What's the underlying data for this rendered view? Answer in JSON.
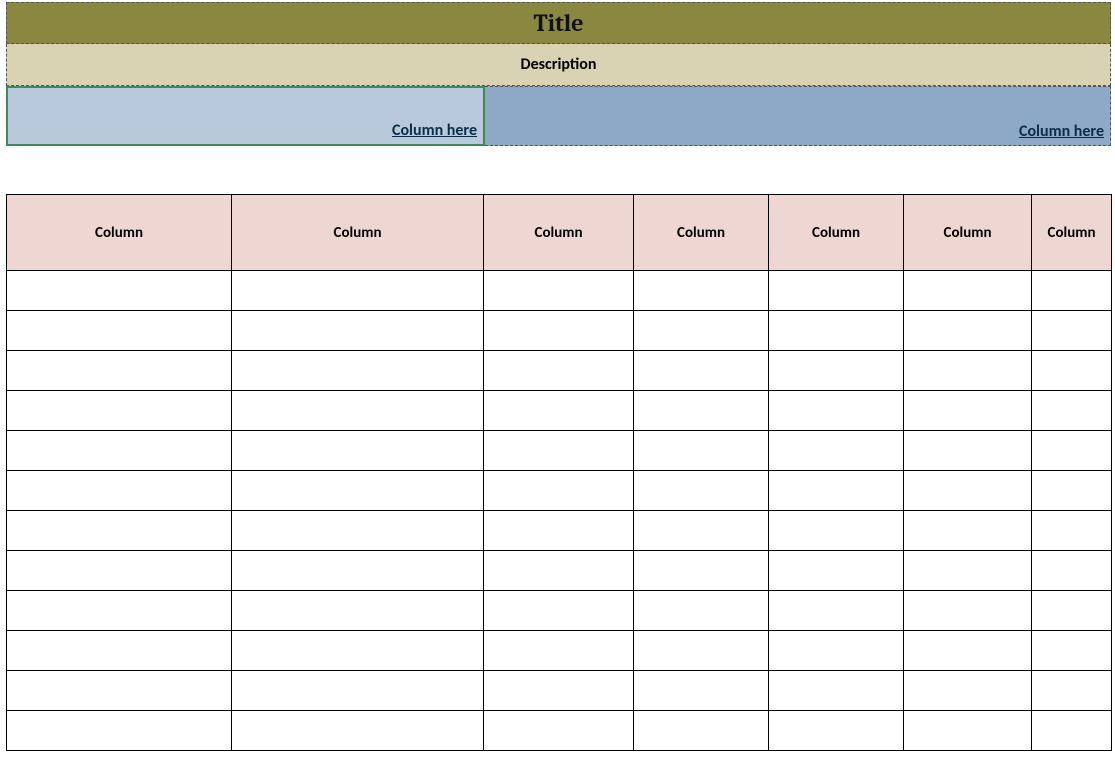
{
  "header": {
    "title": "Title",
    "description": "Description"
  },
  "groups": {
    "left_label": "Column here",
    "right_label": "Column here"
  },
  "table": {
    "columns": [
      "Column",
      "Column",
      "Column",
      "Column",
      "Column",
      "Column",
      "Column"
    ],
    "rows": [
      [
        "",
        "",
        "",
        "",
        "",
        "",
        ""
      ],
      [
        "",
        "",
        "",
        "",
        "",
        "",
        ""
      ],
      [
        "",
        "",
        "",
        "",
        "",
        "",
        ""
      ],
      [
        "",
        "",
        "",
        "",
        "",
        "",
        ""
      ],
      [
        "",
        "",
        "",
        "",
        "",
        "",
        ""
      ],
      [
        "",
        "",
        "",
        "",
        "",
        "",
        ""
      ],
      [
        "",
        "",
        "",
        "",
        "",
        "",
        ""
      ],
      [
        "",
        "",
        "",
        "",
        "",
        "",
        ""
      ],
      [
        "",
        "",
        "",
        "",
        "",
        "",
        ""
      ],
      [
        "",
        "",
        "",
        "",
        "",
        "",
        ""
      ],
      [
        "",
        "",
        "",
        "",
        "",
        "",
        ""
      ],
      [
        "",
        "",
        "",
        "",
        "",
        "",
        ""
      ]
    ]
  },
  "colors": {
    "title_bg": "#8a8740",
    "desc_bg": "#d9d3b3",
    "group_left_bg": "#b8c9dc",
    "group_right_bg": "#8ea9c8",
    "header_bg": "#eed6d3",
    "selection_border": "#3f8a5b"
  }
}
